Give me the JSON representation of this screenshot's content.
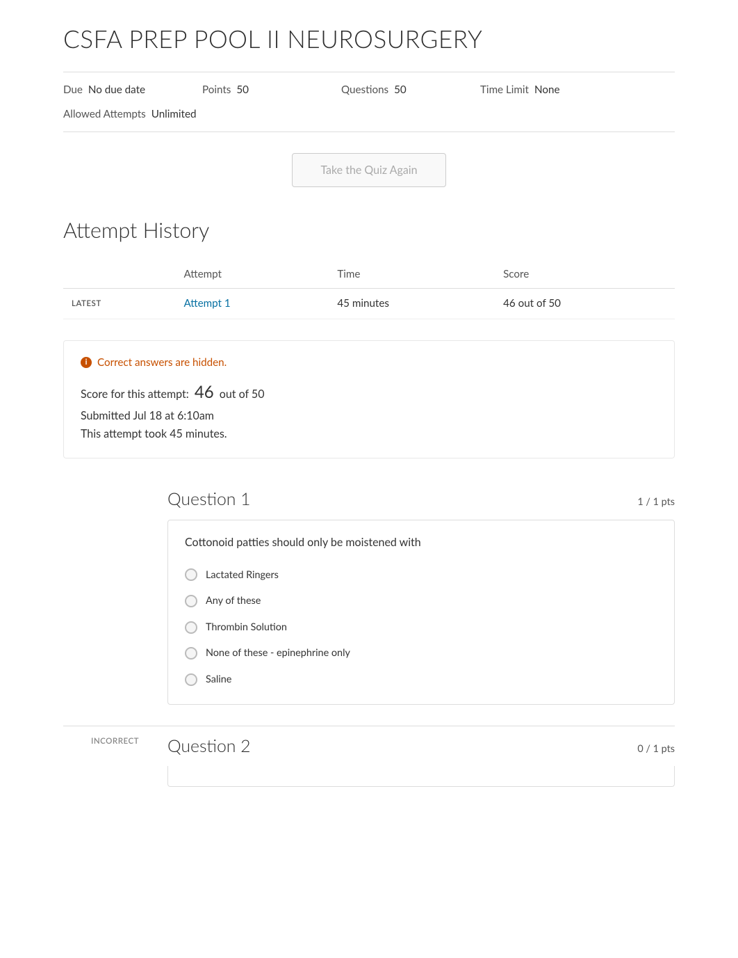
{
  "page": {
    "title": "CSFA PREP POOL II NEUROSURGERY"
  },
  "meta": {
    "due_label": "Due",
    "due_value": "No due date",
    "points_label": "Points",
    "points_value": "50",
    "questions_label": "Questions",
    "questions_value": "50",
    "time_limit_label": "Time Limit",
    "time_limit_value": "None",
    "allowed_attempts_label": "Allowed Attempts",
    "allowed_attempts_value": "Unlimited"
  },
  "take_quiz_btn": "Take the Quiz Again",
  "attempt_history": {
    "title": "Attempt History",
    "table": {
      "col_attempt": "Attempt",
      "col_time": "Time",
      "col_score": "Score",
      "rows": [
        {
          "latest_label": "LATEST",
          "attempt_label": "Attempt 1",
          "time": "45 minutes",
          "score": "46 out of 50"
        }
      ]
    }
  },
  "result_info": {
    "correct_answers_notice": "Correct answers are hidden.",
    "score_prefix": "Score for this attempt:",
    "score_number": "46",
    "score_suffix": "out of 50",
    "submitted": "Submitted Jul 18 at 6:10am",
    "time_took": "This attempt took 45 minutes."
  },
  "questions": [
    {
      "number": "Question 1",
      "pts": "1 / 1 pts",
      "text": "Cottonoid patties should only be moistened with",
      "status": "",
      "answers": [
        {
          "text": "Lactated Ringers"
        },
        {
          "text": "Any of these"
        },
        {
          "text": "Thrombin Solution"
        },
        {
          "text": "None of these - epinephrine only"
        },
        {
          "text": "Saline"
        }
      ]
    },
    {
      "number": "Question 2",
      "pts": "0 / 1 pts",
      "text": "",
      "status": "Incorrect",
      "answers": []
    }
  ]
}
